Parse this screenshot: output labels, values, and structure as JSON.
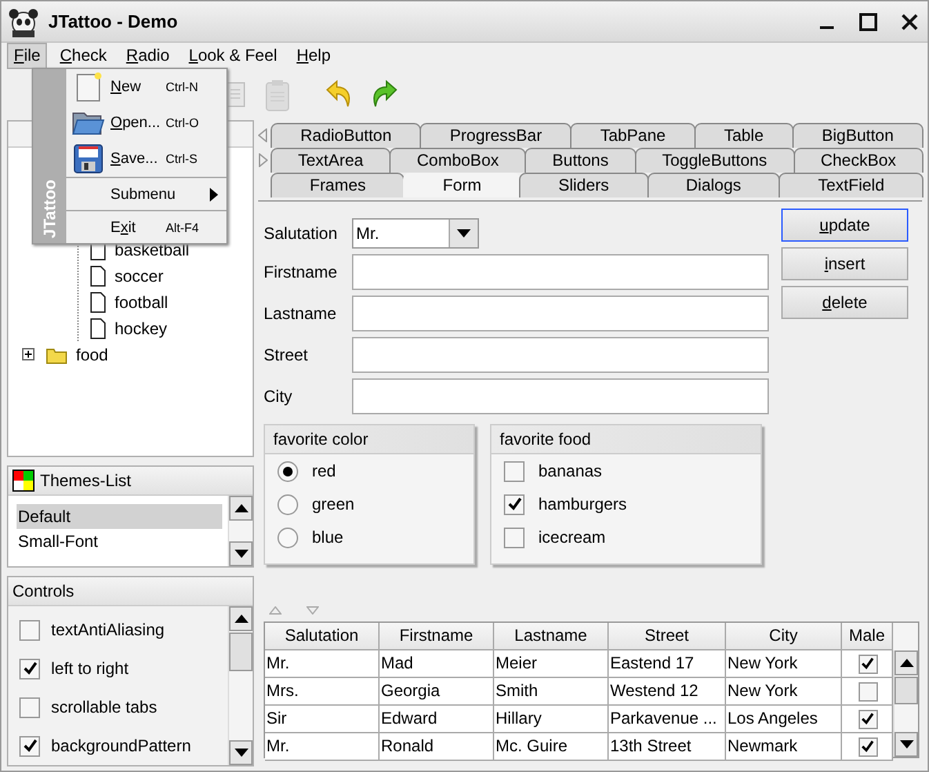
{
  "window": {
    "title": "JTattoo - Demo"
  },
  "menubar": [
    {
      "label": {
        "key": "F",
        "post": "ile"
      },
      "selected": true
    },
    {
      "label": {
        "key": "C",
        "post": "heck"
      },
      "selected": false
    },
    {
      "label": {
        "key": "R",
        "post": "adio"
      },
      "selected": false
    },
    {
      "label": {
        "key": "L",
        "post": "ook & Feel"
      },
      "selected": false
    },
    {
      "label": {
        "key": "H",
        "post": "elp"
      },
      "selected": false
    }
  ],
  "toolbar": [
    {
      "kind": "copy",
      "disabled": true
    },
    {
      "kind": "paste",
      "disabled": true
    },
    {
      "kind": "undo",
      "disabled": false
    },
    {
      "kind": "redo",
      "disabled": false
    }
  ],
  "file_menu": {
    "side_label": "JTattoo",
    "items": [
      {
        "kind": "new",
        "label": {
          "key": "N",
          "post": "ew"
        },
        "shortcut": "Ctrl-N"
      },
      {
        "kind": "open",
        "label": {
          "key": "O",
          "post": "pen..."
        },
        "shortcut": "Ctrl-O"
      },
      {
        "kind": "save",
        "label": {
          "key": "S",
          "post": "ave..."
        },
        "shortcut": "Ctrl-S"
      },
      {
        "kind": "separator"
      },
      {
        "kind": "submenu",
        "label": {
          "pre": "Submenu"
        }
      },
      {
        "kind": "separator"
      },
      {
        "kind": "exit",
        "label": {
          "pre": "E",
          "key": "x",
          "post": "it"
        },
        "shortcut": "Alt-F4"
      }
    ]
  },
  "tree": [
    {
      "children": [
        {
          "label": "basketball"
        },
        {
          "label": "soccer"
        },
        {
          "label": "football"
        },
        {
          "label": "hockey"
        }
      ]
    },
    {
      "label": "food",
      "expanded": false
    }
  ],
  "themes": {
    "title": "Themes-List",
    "items": [
      {
        "label": "Default",
        "selected": true
      },
      {
        "label": "Small-Font",
        "selected": false
      }
    ]
  },
  "controls": {
    "title": "Controls",
    "items": [
      {
        "label": "textAntiAliasing",
        "checked": false
      },
      {
        "label": "left to right",
        "checked": true
      },
      {
        "label": "scrollable tabs",
        "checked": false
      },
      {
        "label": "backgroundPattern",
        "checked": true
      }
    ]
  },
  "tab_rows": [
    {
      "tabs": [
        {
          "label": "RadioButton",
          "selected": false
        },
        {
          "label": "ProgressBar",
          "selected": false
        },
        {
          "label": "TabPane",
          "selected": false
        },
        {
          "label": "Table",
          "selected": false
        },
        {
          "label": "BigButton",
          "selected": false
        }
      ]
    },
    {
      "tabs": [
        {
          "label": "TextArea",
          "selected": false
        },
        {
          "label": "ComboBox",
          "selected": false
        },
        {
          "label": "Buttons",
          "selected": false
        },
        {
          "label": "ToggleButtons",
          "selected": false
        },
        {
          "label": "CheckBox",
          "selected": false
        }
      ]
    },
    {
      "tabs": [
        {
          "label": "Frames",
          "selected": false
        },
        {
          "label": "Form",
          "selected": true
        },
        {
          "label": "Sliders",
          "selected": false
        },
        {
          "label": "Dialogs",
          "selected": false
        },
        {
          "label": "TextField",
          "selected": false
        }
      ]
    }
  ],
  "form": {
    "fields": [
      {
        "label": "Salutation",
        "kind": "combo",
        "value": "Mr."
      },
      {
        "label": "Firstname",
        "kind": "text"
      },
      {
        "label": "Lastname",
        "kind": "text"
      },
      {
        "label": "Street",
        "kind": "text"
      },
      {
        "label": "City",
        "kind": "text"
      }
    ],
    "buttons": [
      {
        "label": {
          "key": "u",
          "post": "pdate"
        },
        "focused": true
      },
      {
        "label": {
          "key": "i",
          "post": "nsert"
        },
        "focused": false
      },
      {
        "label": {
          "key": "d",
          "post": "elete"
        },
        "focused": false
      }
    ],
    "color_group": {
      "title": "favorite color",
      "options": [
        {
          "label": "red",
          "selected": true
        },
        {
          "label": "green",
          "selected": false
        },
        {
          "label": "blue",
          "selected": false
        }
      ]
    },
    "food_group": {
      "title": "favorite food",
      "options": [
        {
          "label": "bananas",
          "checked": false
        },
        {
          "label": "hamburgers",
          "checked": true
        },
        {
          "label": "icecream",
          "checked": false
        }
      ]
    }
  },
  "table": {
    "columns": [
      "Salutation",
      "Firstname",
      "Lastname",
      "Street",
      "City",
      "Male"
    ],
    "rows": [
      {
        "cells": [
          "Mr.",
          "Mad",
          "Meier",
          "Eastend 17",
          "New York"
        ],
        "male": true
      },
      {
        "cells": [
          "Mrs.",
          "Georgia",
          "Smith",
          "Westend 12",
          "New York"
        ],
        "male": false
      },
      {
        "cells": [
          "Sir",
          "Edward",
          "Hillary",
          "Parkavenue ...",
          "Los Angeles"
        ],
        "male": true
      },
      {
        "cells": [
          "Mr.",
          "Ronald",
          "Mc. Guire",
          "13th Street",
          "Newmark"
        ],
        "male": true
      }
    ]
  }
}
